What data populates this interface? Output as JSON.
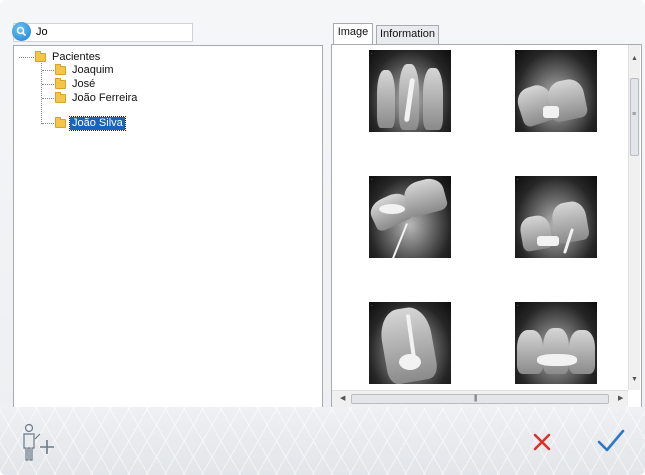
{
  "search": {
    "value": "Jo"
  },
  "tree": {
    "root_label": "Pacientes",
    "items": [
      {
        "label": "Joaquim"
      },
      {
        "label": "José"
      },
      {
        "label": "João Ferreira"
      },
      {
        "label": "João Silva",
        "selected": true
      }
    ]
  },
  "tabs": [
    {
      "label": "Image",
      "active": true
    },
    {
      "label": "Information",
      "active": false
    }
  ],
  "gallery": {
    "thumbnails": [
      {
        "icon": "xray-thumbnail"
      },
      {
        "icon": "xray-thumbnail"
      },
      {
        "icon": "xray-thumbnail"
      },
      {
        "icon": "xray-thumbnail"
      },
      {
        "icon": "xray-thumbnail"
      },
      {
        "icon": "xray-thumbnail"
      }
    ]
  },
  "footer": {
    "add_patient_icon": "person-plus-icon",
    "cancel_icon": "close-icon",
    "confirm_icon": "check-icon",
    "cancel_color": "#d9342b",
    "confirm_color": "#2b78c9"
  }
}
